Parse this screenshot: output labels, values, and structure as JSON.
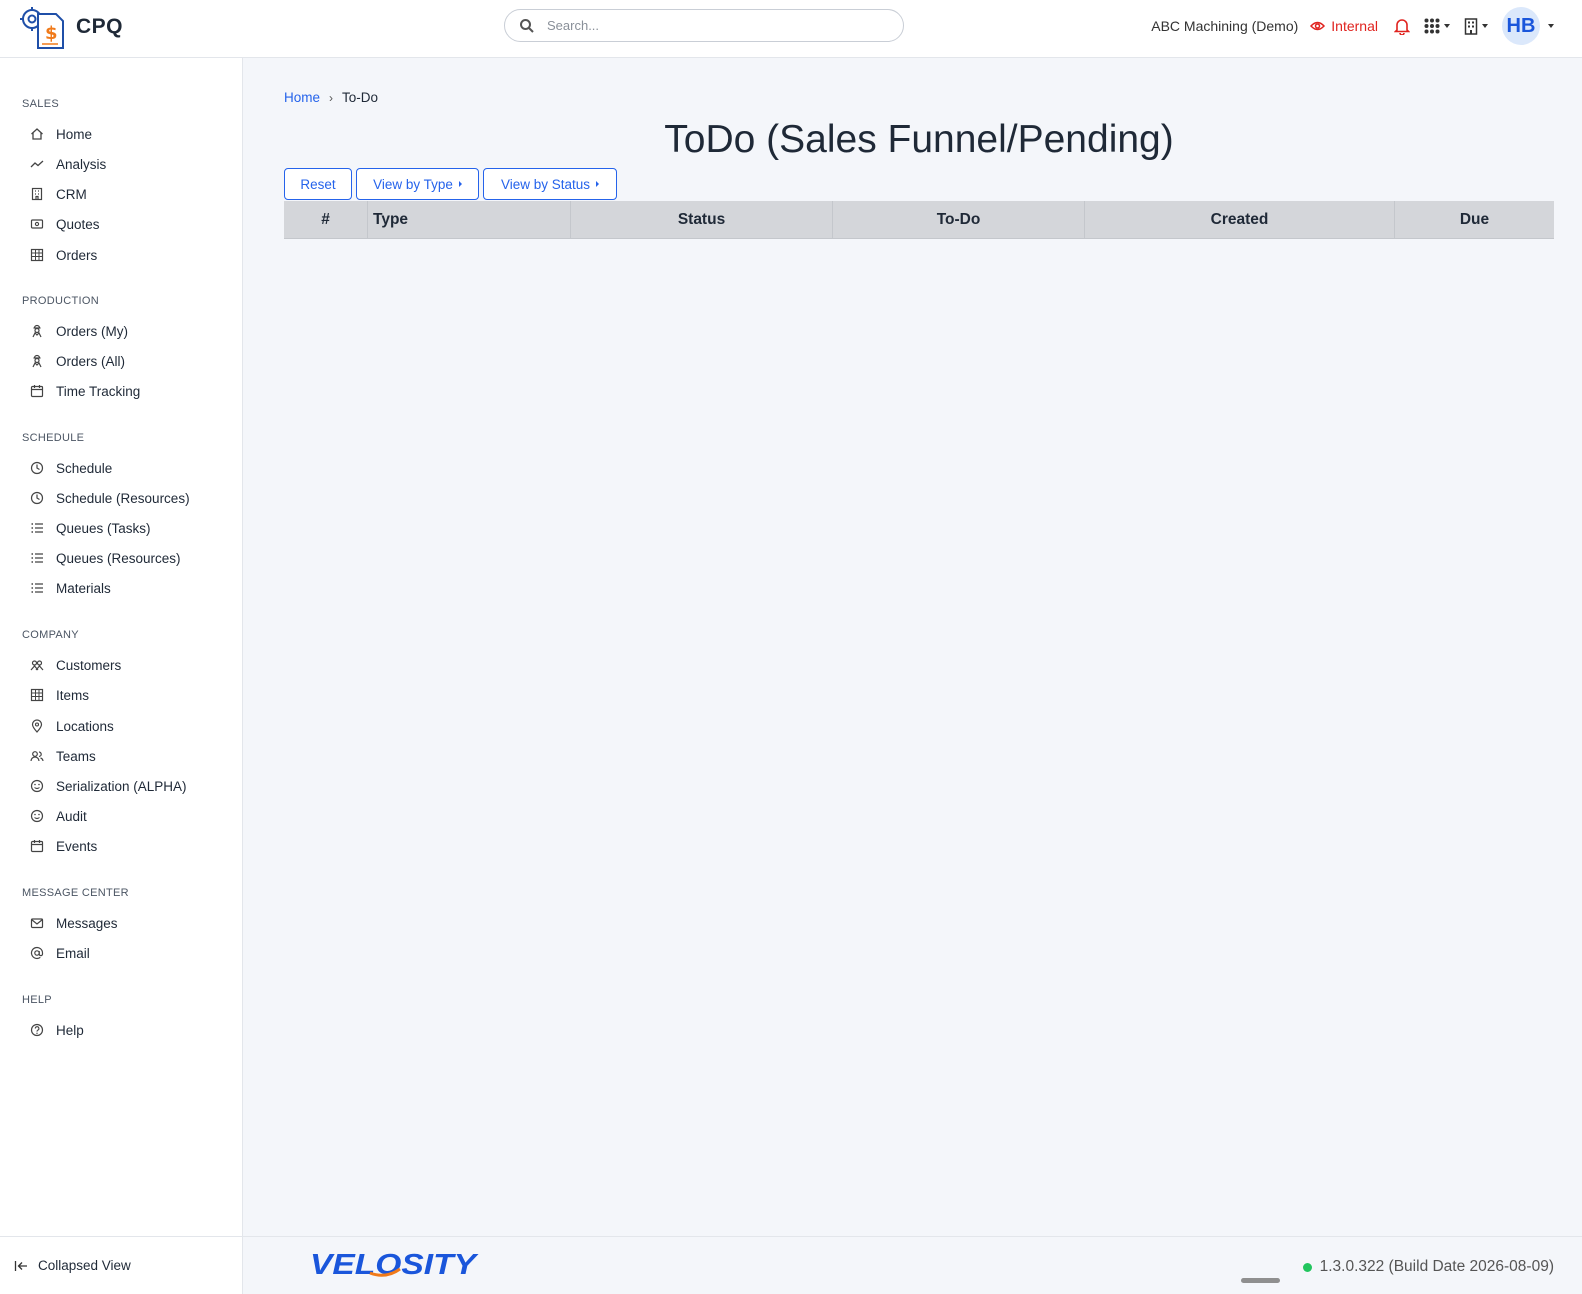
{
  "app": {
    "name": "CPQ"
  },
  "search": {
    "placeholder": "Search..."
  },
  "topbar": {
    "company": "ABC Machining (Demo)",
    "mode": "Internal",
    "avatar_initials": "HB"
  },
  "sidebar": {
    "sections": [
      {
        "title": "SALES",
        "items": [
          {
            "label": "Home",
            "icon": "home-icon"
          },
          {
            "label": "Analysis",
            "icon": "trend-icon"
          },
          {
            "label": "CRM",
            "icon": "building-icon"
          },
          {
            "label": "Quotes",
            "icon": "quote-icon"
          },
          {
            "label": "Orders",
            "icon": "table-icon"
          }
        ]
      },
      {
        "title": "PRODUCTION",
        "items": [
          {
            "label": "Orders (My)",
            "icon": "worker-icon"
          },
          {
            "label": "Orders (All)",
            "icon": "worker-icon"
          },
          {
            "label": "Time Tracking",
            "icon": "calendar-icon"
          }
        ]
      },
      {
        "title": "SCHEDULE",
        "items": [
          {
            "label": "Schedule",
            "icon": "clock-icon"
          },
          {
            "label": "Schedule (Resources)",
            "icon": "clock-icon"
          },
          {
            "label": "Queues (Tasks)",
            "icon": "list-icon"
          },
          {
            "label": "Queues (Resources)",
            "icon": "list-icon"
          },
          {
            "label": "Materials",
            "icon": "list-icon"
          }
        ]
      },
      {
        "title": "COMPANY",
        "items": [
          {
            "label": "Customers",
            "icon": "users-icon"
          },
          {
            "label": "Items",
            "icon": "table-icon"
          },
          {
            "label": "Locations",
            "icon": "pin-icon"
          },
          {
            "label": "Teams",
            "icon": "team-icon"
          },
          {
            "label": "Serialization (ALPHA)",
            "icon": "face-icon"
          },
          {
            "label": "Audit",
            "icon": "face-icon"
          },
          {
            "label": "Events",
            "icon": "calendar-icon"
          }
        ]
      },
      {
        "title": "MESSAGE CENTER",
        "items": [
          {
            "label": "Messages",
            "icon": "mail-icon"
          },
          {
            "label": "Email",
            "icon": "at-icon"
          }
        ]
      },
      {
        "title": "HELP",
        "items": [
          {
            "label": "Help",
            "icon": "help-icon"
          }
        ]
      }
    ],
    "collapse_label": "Collapsed View"
  },
  "breadcrumb": {
    "home": "Home",
    "current": "To-Do"
  },
  "page": {
    "title": "ToDo (Sales Funnel/Pending)"
  },
  "toolbar": {
    "reset": "Reset",
    "view_by_type": "View by Type",
    "view_by_status": "View by Status"
  },
  "table": {
    "columns": [
      "#",
      "Type",
      "Status",
      "To-Do",
      "Created",
      "Due"
    ]
  },
  "footer": {
    "brand": "VELOSITY",
    "version": "1.3.0.322 (Build Date 2026-08-09)"
  },
  "colors": {
    "accent": "#2563eb",
    "internal": "#e0231f",
    "status_ok": "#22c55e"
  }
}
